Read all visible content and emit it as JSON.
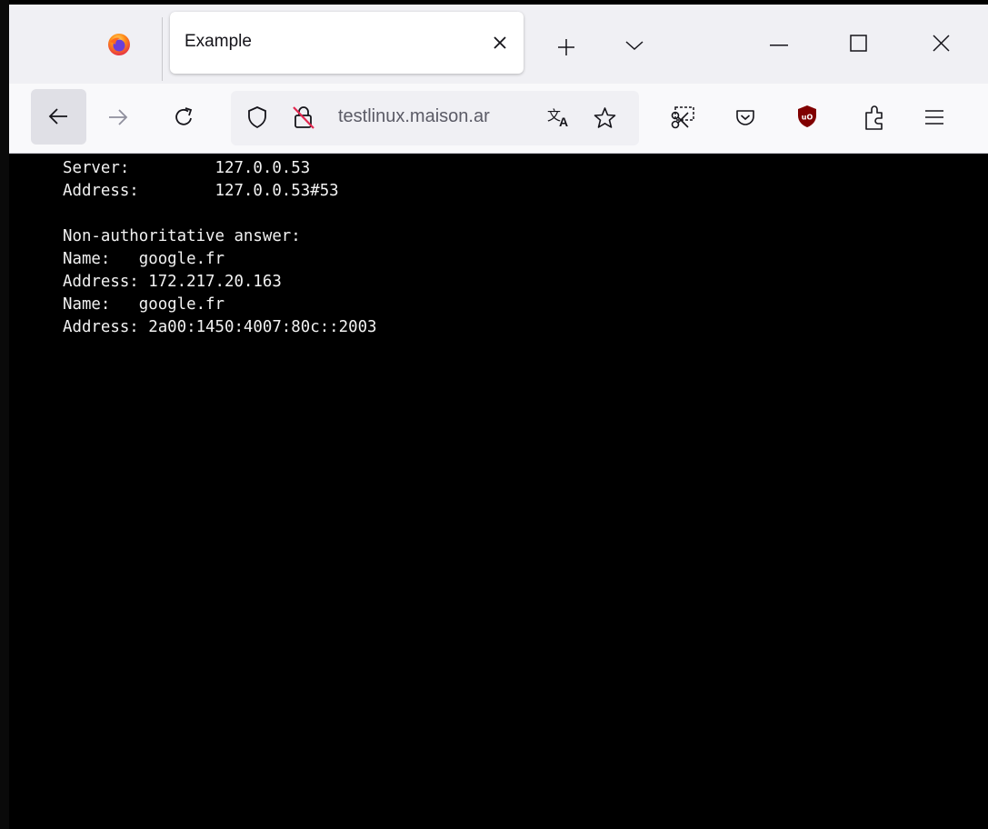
{
  "browser": {
    "tab": {
      "title": "Example"
    },
    "url": "testlinux.maison.ar"
  },
  "terminal": {
    "lines": [
      "Server:         127.0.0.53",
      "Address:        127.0.0.53#53",
      "",
      "Non-authoritative answer:",
      "Name:   google.fr",
      "Address: 172.217.20.163",
      "Name:   google.fr",
      "Address: 2a00:1450:4007:80c::2003"
    ]
  },
  "icons": {
    "browser_logo": "firefox-logo-icon",
    "tab_close": "close-icon",
    "new_tab": "plus-icon",
    "list_tabs": "chevron-down-icon",
    "minimize": "minimize-icon",
    "maximize": "maximize-icon",
    "close_window": "close-icon",
    "back": "arrow-left-icon",
    "forward": "arrow-right-icon",
    "reload": "reload-icon",
    "tracking_protection": "shield-icon",
    "connection": "insecure-lock-icon",
    "translate": "translate-icon",
    "bookmark": "star-icon",
    "screenshot": "scissors-icon",
    "pocket": "pocket-icon",
    "ublock": "ublock-origin-icon",
    "extensions": "puzzle-icon",
    "menu": "hamburger-menu-icon"
  },
  "colors": {
    "tabbar_bg": "#f0f0f4",
    "navbar_bg": "#f9f9fb",
    "content_bg": "#000000",
    "terminal_text": "#f2f2f2",
    "ublock_red": "#800000"
  }
}
